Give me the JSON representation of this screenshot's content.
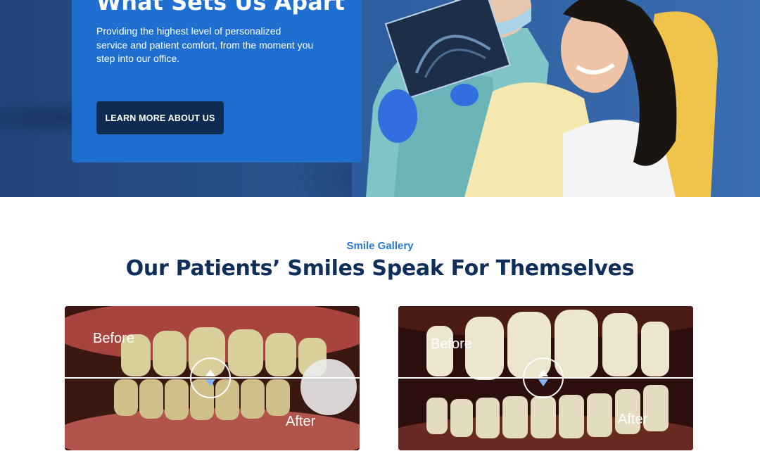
{
  "hero": {
    "title": "What Sets Us Apart",
    "description": "Providing the highest level of personalized service and patient comfort, from the moment you step into our office.",
    "cta_label": "LEARN MORE ABOUT US",
    "card_color": "#1f6fd1",
    "button_color": "#0e2b52"
  },
  "gallery": {
    "eyebrow": "Smile Gallery",
    "title": "Our Patients’ Smiles Speak For Themselves",
    "accent_color": "#2a78d6",
    "title_color": "#0f2f5a",
    "comparisons": [
      {
        "before_label": "Before",
        "after_label": "After"
      },
      {
        "before_label": "Before",
        "after_label": "After"
      }
    ]
  }
}
